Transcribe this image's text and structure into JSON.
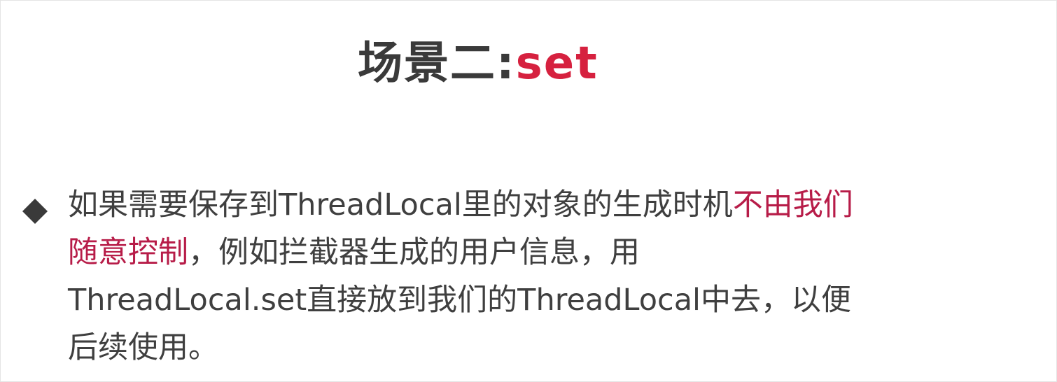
{
  "slide": {
    "title": {
      "main": "场景二:",
      "accent": "set"
    },
    "bullet": {
      "icon": "diamond-bullet-icon",
      "line1_before": "如果需要保存到ThreadLocal里的对象的生成时机",
      "line1_accent": "不由我们",
      "line2_accent": "随意控制",
      "line2_after": "，例如拦截器生成的用户信息，用",
      "line3": "ThreadLocal.set直接放到我们的ThreadLocal中去，以便",
      "line4": "后续使用。"
    },
    "colors": {
      "title_text": "#3a3a3a",
      "title_accent": "#d6213f",
      "body_text": "#3f3f3f",
      "body_accent": "#b71c48",
      "bullet": "#3a3a3a"
    }
  }
}
